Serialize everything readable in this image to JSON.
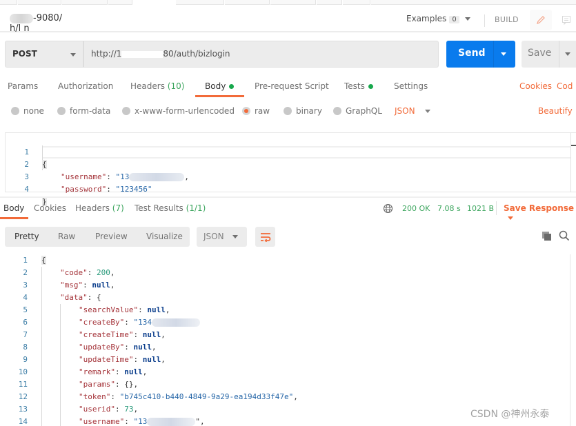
{
  "title_bar": {
    "request_name_visible": "-9080/ h/l n",
    "examples_label": "Examples",
    "examples_count": "0",
    "build_label": "BUILD"
  },
  "url_bar": {
    "method": "POST",
    "url_prefix": "http://1",
    "url_suffix": "80/auth/bizlogin",
    "send_label": "Send",
    "save_label": "Save"
  },
  "request_tabs": {
    "items": [
      {
        "label": "Params"
      },
      {
        "label": "Authorization"
      },
      {
        "label": "Headers",
        "count": "(10)"
      },
      {
        "label": "Body",
        "dot": true,
        "active": true
      },
      {
        "label": "Pre-request Script"
      },
      {
        "label": "Tests",
        "dot": true
      },
      {
        "label": "Settings"
      }
    ],
    "cookies_link": "Cookies",
    "code_link": "Cod"
  },
  "body_types": {
    "options": [
      "none",
      "form-data",
      "x-www-form-urlencoded",
      "raw",
      "binary",
      "GraphQL"
    ],
    "selected": "raw",
    "format": "JSON",
    "beautify_label": "Beautify"
  },
  "request_body": {
    "lines": [
      {
        "n": "1",
        "text": "{"
      },
      {
        "n": "2",
        "key": "\"username\"",
        "value": "\"13",
        "tail": ","
      },
      {
        "n": "3",
        "key": "\"password\"",
        "value": "\"123456\"",
        "tail": ""
      },
      {
        "n": "4",
        "text": "}"
      }
    ]
  },
  "response_tabs": {
    "items": [
      {
        "label": "Body",
        "active": true
      },
      {
        "label": "Cookies"
      },
      {
        "label": "Headers",
        "count": "(7)"
      },
      {
        "label": "Test Results",
        "count": "(1/1)"
      }
    ],
    "status": "200 OK",
    "time": "7.08 s",
    "size": "1021 B",
    "save_response_label": "Save Response"
  },
  "response_view": {
    "modes": [
      "Pretty",
      "Raw",
      "Preview",
      "Visualize"
    ],
    "selected_mode": "Pretty",
    "format": "JSON"
  },
  "response_body": {
    "lines": [
      {
        "n": "1",
        "indent": 0,
        "text": "{"
      },
      {
        "n": "2",
        "indent": 1,
        "key": "\"code\"",
        "num": "200",
        "tail": ","
      },
      {
        "n": "3",
        "indent": 1,
        "key": "\"msg\"",
        "nul": "null",
        "tail": ","
      },
      {
        "n": "4",
        "indent": 1,
        "key": "\"data\"",
        "punc": "{",
        "tail": ""
      },
      {
        "n": "5",
        "indent": 2,
        "key": "\"searchValue\"",
        "nul": "null",
        "tail": ","
      },
      {
        "n": "6",
        "indent": 2,
        "key": "\"createBy\"",
        "str": "\"134",
        "tail": ""
      },
      {
        "n": "7",
        "indent": 2,
        "key": "\"createTime\"",
        "nul": "null",
        "tail": ","
      },
      {
        "n": "8",
        "indent": 2,
        "key": "\"updateBy\"",
        "nul": "null",
        "tail": ","
      },
      {
        "n": "9",
        "indent": 2,
        "key": "\"updateTime\"",
        "nul": "null",
        "tail": ","
      },
      {
        "n": "10",
        "indent": 2,
        "key": "\"remark\"",
        "nul": "null",
        "tail": ","
      },
      {
        "n": "11",
        "indent": 2,
        "key": "\"params\"",
        "punc": "{}",
        "tail": ","
      },
      {
        "n": "12",
        "indent": 2,
        "key": "\"token\"",
        "str": "\"b745c410-b440-4849-9a29-ea194d33f47e\"",
        "tail": ","
      },
      {
        "n": "13",
        "indent": 2,
        "key": "\"userid\"",
        "num": "73",
        "tail": ","
      },
      {
        "n": "14",
        "indent": 2,
        "key": "\"username\"",
        "str": "\"13",
        "tail": "\","
      }
    ]
  },
  "watermark": "CSDN @神州永泰",
  "colors": {
    "accent": "#f26b3a",
    "send_blue": "#097bed",
    "status_green": "#3ba55d"
  }
}
